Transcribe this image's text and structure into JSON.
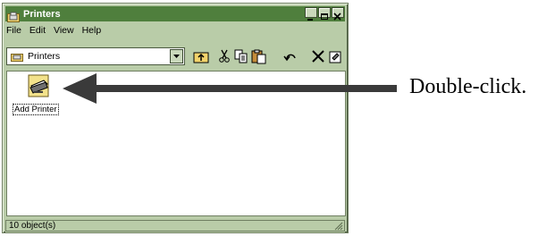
{
  "window": {
    "title": "Printers",
    "controls": [
      "minimize",
      "maximize",
      "close"
    ]
  },
  "menu": {
    "items": [
      "File",
      "Edit",
      "View",
      "Help"
    ]
  },
  "toolbar": {
    "address_value": "Printers",
    "buttons": [
      "up-folder",
      "cut",
      "copy",
      "paste",
      "undo",
      "delete",
      "properties"
    ]
  },
  "content": {
    "items": [
      {
        "label": "Add Printer",
        "icon": "add-printer-icon"
      }
    ]
  },
  "status": {
    "text": "10 object(s)"
  },
  "annotation": {
    "caption": "Double-click."
  },
  "colors": {
    "title_bar": "#4f7f3d",
    "window_face": "#b9cca8",
    "arrow": "#3a3a3a"
  }
}
